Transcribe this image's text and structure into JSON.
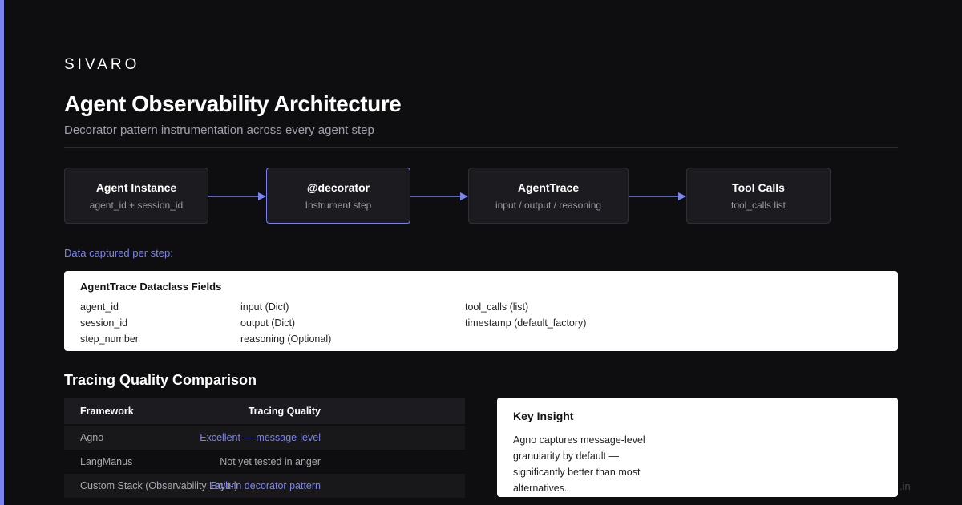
{
  "brand": "SIVARO",
  "title": "Agent Observability Architecture",
  "subtitle": "Decorator pattern instrumentation across every agent step",
  "flow": [
    {
      "name": "Agent Instance",
      "desc": "agent_id + session_id"
    },
    {
      "name": "@decorator",
      "desc": "Instrument step"
    },
    {
      "name": "AgentTrace",
      "desc": "input / output / reasoning"
    },
    {
      "name": "Tool Calls",
      "desc": "tool_calls list"
    }
  ],
  "captured_label": "Data captured per step:",
  "fields_card": {
    "title": "AgentTrace Dataclass Fields",
    "fields": [
      "agent_id",
      "session_id",
      "step_number",
      "input (Dict)",
      "output (Dict)",
      "reasoning (Optional)",
      "tool_calls (list)",
      "timestamp (default_factory)"
    ]
  },
  "comparison": {
    "heading": "Tracing Quality Comparison",
    "headers": [
      "Framework",
      "Tracing Quality"
    ],
    "rows": [
      {
        "framework": "Agno",
        "quality": "Excellent — message-level"
      },
      {
        "framework": "LangManus",
        "quality": "Not yet tested in anger"
      },
      {
        "framework": "Custom Stack (Observability Layer)",
        "quality": "Built-in decorator pattern"
      }
    ]
  },
  "insight": {
    "title": "Key Insight",
    "body": "Agno captures message-level granularity by default — significantly better than most alternatives."
  },
  "watermark": ".in",
  "colors": {
    "accent": "#7a83f0",
    "background": "#0e0e10",
    "card": "#ffffff"
  }
}
